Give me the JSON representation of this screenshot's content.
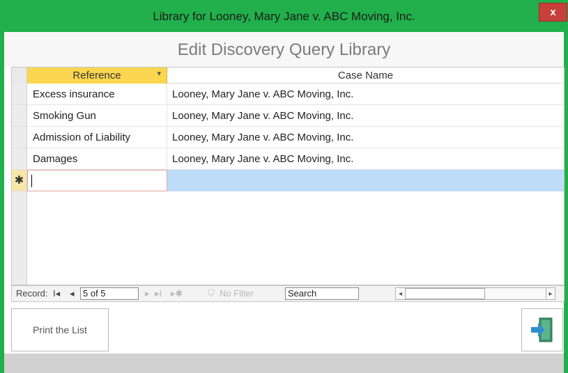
{
  "window": {
    "title": "Library for Looney, Mary Jane v. ABC Moving, Inc.",
    "close_label": "x",
    "accent_color": "#21b04b"
  },
  "form": {
    "heading": "Edit Discovery Query Library"
  },
  "datasheet": {
    "columns": [
      "Reference",
      "Case Name"
    ],
    "sort_indicator_icon": "dropdown-arrow-icon",
    "rows": [
      {
        "reference": "Excess insurance",
        "case_name": "Looney, Mary Jane v. ABC Moving, Inc."
      },
      {
        "reference": "Smoking Gun",
        "case_name": "Looney, Mary Jane v. ABC Moving, Inc."
      },
      {
        "reference": "Admission of Liability",
        "case_name": "Looney, Mary Jane v. ABC Moving, Inc."
      },
      {
        "reference": "Damages",
        "case_name": "Looney, Mary Jane v. ABC Moving, Inc."
      }
    ],
    "new_record_marker": "✱"
  },
  "navigation": {
    "record_label": "Record:",
    "first_glyph": "I◂",
    "prev_glyph": "◂",
    "position_value": "5 of 5",
    "next_glyph": "▸",
    "last_glyph": "▸I",
    "new_glyph": "▸✱",
    "filter_label": "No Filter",
    "search_value": "Search",
    "scroll_left_glyph": "◂",
    "scroll_right_glyph": "▸"
  },
  "footer": {
    "print_label": "Print the List",
    "exit_icon": "exit-door-icon"
  }
}
